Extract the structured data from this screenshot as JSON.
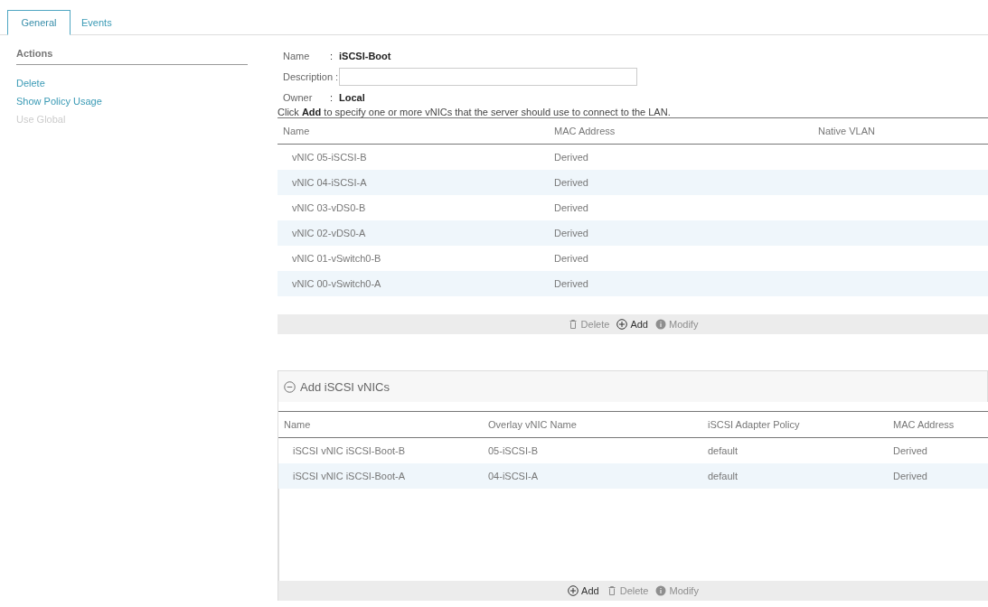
{
  "tabs": [
    {
      "label": "General",
      "selected": true
    },
    {
      "label": "Events",
      "selected": false
    }
  ],
  "actions": {
    "title": "Actions",
    "items": [
      {
        "label": "Delete",
        "disabled": false
      },
      {
        "label": "Show Policy Usage",
        "disabled": false
      },
      {
        "label": "Use Global",
        "disabled": true
      }
    ]
  },
  "properties": {
    "separator": ":",
    "name_label": "Name",
    "name_value": "iSCSI-Boot",
    "description_label": "Description :",
    "owner_label": "Owner",
    "owner_value": "Local"
  },
  "hint": "Click **Add** to specify one or more vNICs that the server should use to connect to the LAN.",
  "vnic_table": {
    "columns": [
      "Name",
      "MAC Address",
      "Native VLAN"
    ],
    "rows": [
      [
        "vNIC 05-iSCSI-B",
        "Derived"
      ],
      [
        "vNIC 04-iSCSI-A",
        "Derived"
      ],
      [
        "vNIC 03-vDS0-B",
        "Derived"
      ],
      [
        "vNIC 02-vDS0-A",
        "Derived"
      ],
      [
        "vNIC 01-vSwitch0-B",
        "Derived"
      ],
      [
        "vNIC 00-vSwitch0-A",
        "Derived"
      ]
    ],
    "toolbar": [
      {
        "kind": "delete",
        "label": "Delete",
        "disabled": true
      },
      {
        "kind": "add",
        "label": "Add",
        "disabled": false
      },
      {
        "kind": "modify",
        "label": "Modify",
        "disabled": true
      }
    ]
  },
  "iscsi_section": {
    "title": "Add iSCSI vNICs",
    "expanded": true,
    "columns": [
      "Name",
      "Overlay vNIC Name",
      "iSCSI Adapter Policy",
      "MAC Address"
    ],
    "rows": [
      [
        "iSCSI vNIC iSCSI-Boot-B",
        "05-iSCSI-B",
        "default",
        "Derived"
      ],
      [
        "iSCSI vNIC iSCSI-Boot-A",
        "04-iSCSI-A",
        "default",
        "Derived"
      ]
    ],
    "toolbar": [
      {
        "kind": "add",
        "label": "Add",
        "disabled": false
      },
      {
        "kind": "delete",
        "label": "Delete",
        "disabled": true
      },
      {
        "kind": "modify",
        "label": "Modify",
        "disabled": true
      }
    ]
  }
}
